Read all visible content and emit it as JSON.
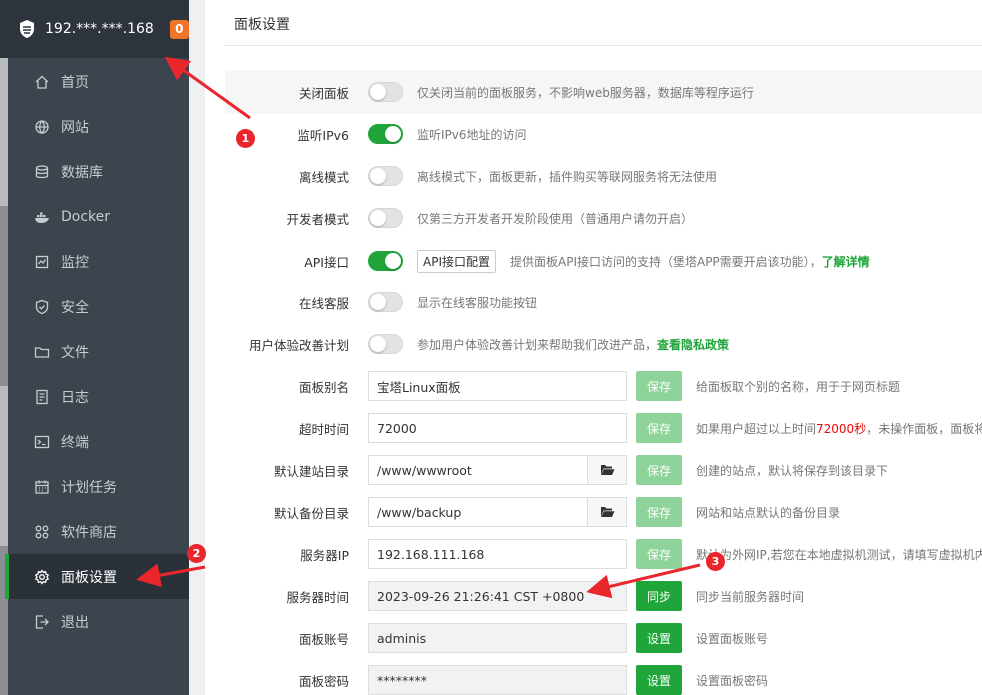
{
  "sidebar": {
    "host": "192.***.***.168",
    "badge": "0",
    "items": [
      {
        "label": "首页",
        "icon": "home-icon"
      },
      {
        "label": "网站",
        "icon": "globe-icon"
      },
      {
        "label": "数据库",
        "icon": "database-icon"
      },
      {
        "label": "Docker",
        "icon": "docker-icon"
      },
      {
        "label": "监控",
        "icon": "monitor-icon"
      },
      {
        "label": "安全",
        "icon": "shield-icon"
      },
      {
        "label": "文件",
        "icon": "folder-icon"
      },
      {
        "label": "日志",
        "icon": "log-icon"
      },
      {
        "label": "终端",
        "icon": "terminal-icon"
      },
      {
        "label": "计划任务",
        "icon": "calendar-icon"
      },
      {
        "label": "软件商店",
        "icon": "apps-icon"
      },
      {
        "label": "面板设置",
        "icon": "gear-icon"
      },
      {
        "label": "退出",
        "icon": "logout-icon"
      }
    ],
    "active": "面板设置"
  },
  "main": {
    "title": "面板设置",
    "toggles": [
      {
        "label": "关闭面板",
        "on": false,
        "desc": "仅关闭当前的面板服务，不影响web服务器，数据库等程序运行"
      },
      {
        "label": "监听IPv6",
        "on": true,
        "desc": "监听IPv6地址的访问"
      },
      {
        "label": "离线模式",
        "on": false,
        "desc": "离线模式下，面板更新，插件购买等联网服务将无法使用"
      },
      {
        "label": "开发者模式",
        "on": false,
        "desc": "仅第三方开发者开发阶段使用（普通用户请勿开启）"
      },
      {
        "label": "API接口",
        "on": true,
        "button": "API接口配置",
        "desc": "提供面板API接口访问的支持（堡塔APP需要开启该功能），",
        "link": "了解详情"
      },
      {
        "label": "在线客服",
        "on": false,
        "desc": "显示在线客服功能按钮"
      },
      {
        "label": "用户体验改善计划",
        "on": false,
        "desc": "参加用户体验改善计划来帮助我们改进产品，",
        "link": "查看隐私政策"
      }
    ],
    "fields": {
      "alias": {
        "label": "面板别名",
        "value": "宝塔Linux面板",
        "button": "保存",
        "desc": "给面板取个别的名称，用于于网页标题"
      },
      "timeout": {
        "label": "超时时间",
        "value": "72000",
        "button": "保存",
        "desc_a": "如果用户超过以上时间",
        "desc_red": "72000秒",
        "desc_b": "，未操作面板，面板将"
      },
      "site_dir": {
        "label": "默认建站目录",
        "value": "/www/wwwroot",
        "button": "保存",
        "desc": "创建的站点，默认将保存到该目录下"
      },
      "backup_dir": {
        "label": "默认备份目录",
        "value": "/www/backup",
        "button": "保存",
        "desc": "网站和站点默认的备份目录"
      },
      "server_ip": {
        "label": "服务器IP",
        "value": "192.168.111.168",
        "button": "保存",
        "desc": "默认为外网IP,若您在本地虚拟机测试，请填写虚拟机内"
      },
      "server_time": {
        "label": "服务器时间",
        "value": "2023-09-26 21:26:41 CST +0800",
        "button": "同步",
        "desc": "同步当前服务器时间"
      },
      "account": {
        "label": "面板账号",
        "value": "adminis",
        "button": "设置",
        "desc": "设置面板账号"
      },
      "password": {
        "label": "面板密码",
        "value": "********",
        "button": "设置",
        "desc": "设置面板密码"
      }
    }
  },
  "annotations": [
    "1",
    "2",
    "3"
  ],
  "colors": {
    "accent": "#20a53a",
    "sidebar": "#3c444d",
    "badge": "#f0752a",
    "annotation": "#e8262b"
  }
}
